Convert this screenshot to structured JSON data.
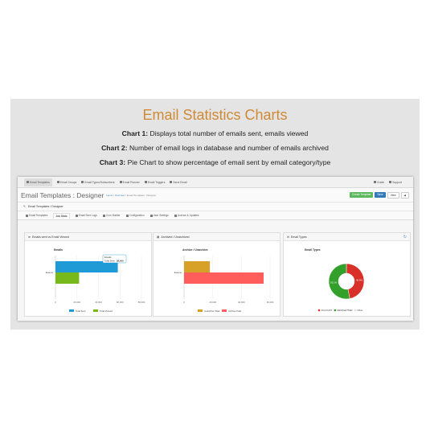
{
  "heading": "Email Statistics Charts",
  "descriptions": [
    {
      "label": "Chart 1:",
      "text": " Displays total number of emails sent, emails viewed"
    },
    {
      "label": "Chart 2:",
      "text": " Number of email logs in database and number of emails archived"
    },
    {
      "label": "Chart 3:",
      "text": " Pie Chart to show percentage of email sent by email category/type"
    }
  ],
  "nav": {
    "items": [
      "Email Templates",
      "Email Groups",
      "Email Types/Subscribers",
      "Email Planner",
      "Email Triggers",
      "Send Email"
    ],
    "right": [
      "Guide",
      "Support"
    ]
  },
  "header": {
    "title": "Email Templates : Designer",
    "crumbs": [
      "Home",
      "Overview",
      "Email Templates : Designer"
    ],
    "buttons": [
      "Create Template",
      "Save",
      "View",
      ""
    ]
  },
  "panel_title": "Email Templates / Designer",
  "tabs": [
    "Email Templates",
    "Job Stats",
    "Email Sent Logs",
    "Cron Builder",
    "Configuration",
    "User Settings",
    "License & Updates"
  ],
  "boxes": [
    {
      "title": "Emails sent vs Email Viewed"
    },
    {
      "title": "Archived / Unarchived"
    },
    {
      "title": "Email Types",
      "refresh_icon": "↻"
    }
  ],
  "chart_data": [
    {
      "type": "bar",
      "orientation": "horizontal",
      "title": "Emails",
      "categories": [
        "Exams"
      ],
      "series": [
        {
          "name": "Total Sent",
          "values": [
            58000
          ],
          "color": "#1f9ad6"
        },
        {
          "name": "Total Viewed",
          "values": [
            22000
          ],
          "color": "#77b81b"
        }
      ],
      "xlim": [
        0,
        80000
      ],
      "xticks": [
        "0",
        "20,000",
        "40,000",
        "60,000",
        "80,000"
      ],
      "tooltip": {
        "title": "Emails",
        "label": "Total Sent:",
        "value": "58,000"
      },
      "legend": "bottom"
    },
    {
      "type": "bar",
      "orientation": "horizontal",
      "title": "Archive / Unarchive",
      "categories": [
        "Exams"
      ],
      "series": [
        {
          "name": "Unarchive Total",
          "values": [
            12000
          ],
          "color": "#d6a126"
        },
        {
          "name": "Archive Total",
          "values": [
            37000
          ],
          "color": "#ff5c5c"
        }
      ],
      "xlim": [
        0,
        40000
      ],
      "xticks": [
        "0",
        "20,000",
        "40,000",
        "60,000"
      ],
      "legend": "bottom"
    },
    {
      "type": "pie",
      "title": "Email Types",
      "series": [
        {
          "name": "ACCOUNT",
          "value": 46.9,
          "label": "46.9%",
          "color": "#d9302a"
        },
        {
          "name": "NEWSLETTER",
          "value": 53.1,
          "label": "53.1%",
          "color": "#33a02c"
        },
        {
          "name": "Other",
          "value": 0,
          "label": "",
          "color": "#e0e0e0"
        }
      ],
      "legend": "bottom"
    }
  ]
}
